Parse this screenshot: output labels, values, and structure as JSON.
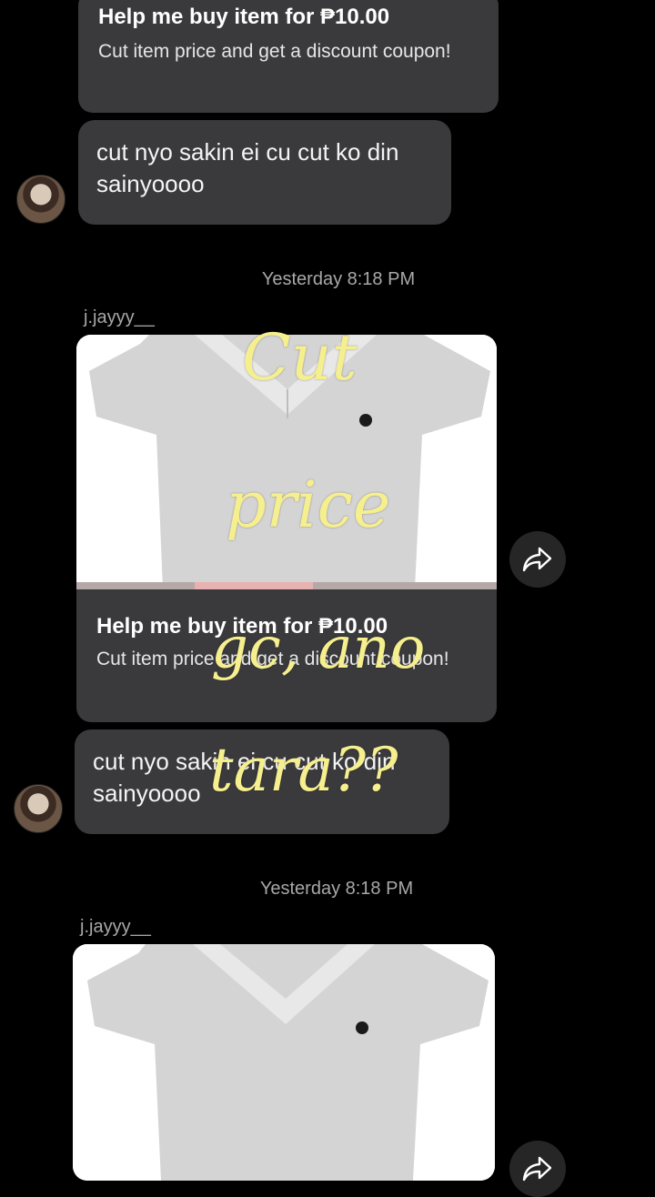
{
  "messages": {
    "top_card": {
      "title": "Help me buy item for ₱10.00",
      "subtitle": "Cut item price and get a discount coupon!"
    },
    "top_bubble": {
      "text": "cut nyo sakin ei cu cut ko din sainyoooo"
    },
    "group1": {
      "timestamp": "Yesterday 8:18 PM",
      "sender": "j.jayyy__",
      "card": {
        "title": "Help me buy item for ₱10.00",
        "subtitle": "Cut item price and get a discount coupon!"
      },
      "bubble": {
        "text": "cut nyo sakin ei cu cut ko din sainyoooo"
      }
    },
    "group2": {
      "timestamp": "Yesterday 8:18 PM",
      "sender": "j.jayyy__"
    }
  },
  "overlay": {
    "line1": "Cut",
    "line2": "price",
    "line3": "gc, ano",
    "line4": "tara??",
    "color": "#f6ef8e"
  },
  "icons": {
    "share": "share-arrow-icon",
    "avatar": "avatar"
  },
  "colors": {
    "bubble": "#3a3a3c",
    "background": "#000000",
    "meta_text": "#a8a8a8"
  }
}
